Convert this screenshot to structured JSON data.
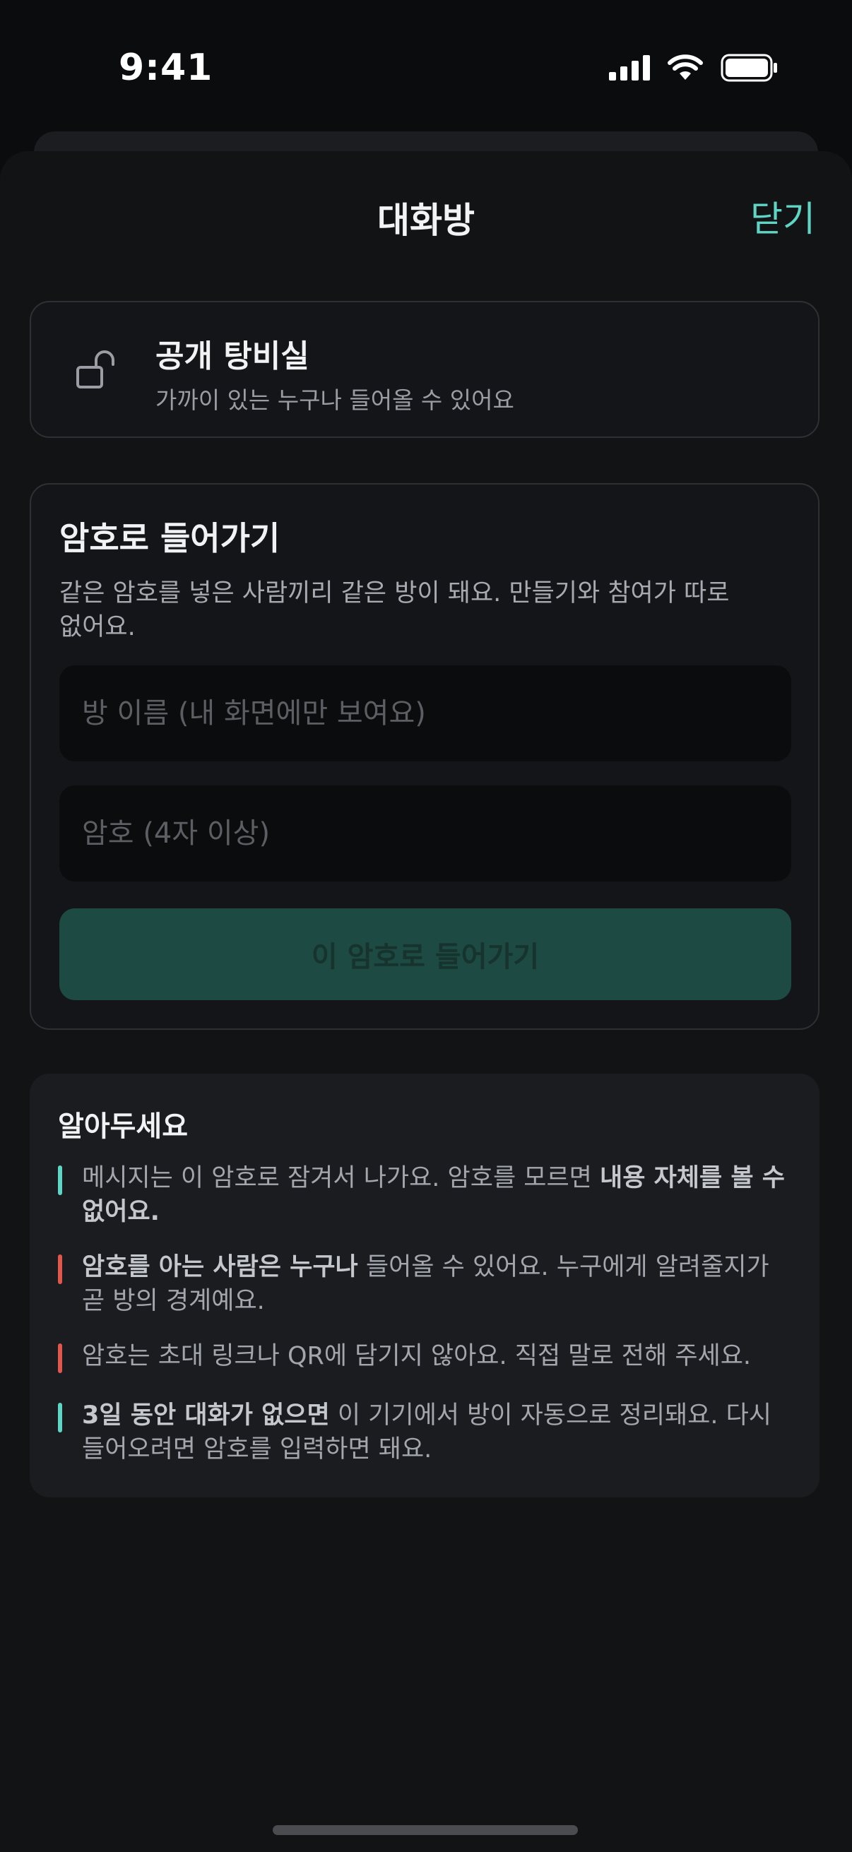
{
  "status_bar": {
    "time": "9:41"
  },
  "sheet": {
    "title": "대화방",
    "close_label": "닫기"
  },
  "public_room": {
    "title": "공개 탕비실",
    "description": "가까이 있는 누구나 들어올 수 있어요",
    "icon": "unlocked-padlock-icon"
  },
  "password_room": {
    "title": "암호로 들어가기",
    "description": "같은 암호를 넣은 사람끼리 같은 방이 돼요. 만들기와 참여가 따로 없어요.",
    "room_name_placeholder": "방 이름 (내 화면에만 보여요)",
    "room_name_value": "",
    "password_placeholder": "암호 (4자 이상)",
    "password_value": "",
    "submit_label": "이 암호로 들어가기"
  },
  "notice": {
    "title": "알아두세요",
    "items": [
      {
        "color": "#5fd6c5",
        "pre": "메시지는 이 암호로 잠겨서 나가요. 암호를 모르면 ",
        "bold": "내용 자체를 볼 수 없어요.",
        "post": ""
      },
      {
        "color": "#e2574c",
        "pre": "",
        "bold": "암호를 아는 사람은 누구나",
        "post": " 들어올 수 있어요. 누구에게 알려줄지가 곧 방의 경계예요."
      },
      {
        "color": "#e2574c",
        "pre": "암호는 초대 링크나 QR에 담기지 않아요. 직접 말로 전해 주세요.",
        "bold": "",
        "post": ""
      },
      {
        "color": "#5fd6c5",
        "pre": "",
        "bold": "3일 동안 대화가 없으면",
        "post": " 이 기기에서 방이 자동으로 정리돼요. 다시 들어오려면 암호를 입력하면 돼요."
      }
    ]
  },
  "colors": {
    "accent": "#5fd6c5",
    "warning": "#e2574c",
    "button_disabled": "#1d4a42"
  }
}
